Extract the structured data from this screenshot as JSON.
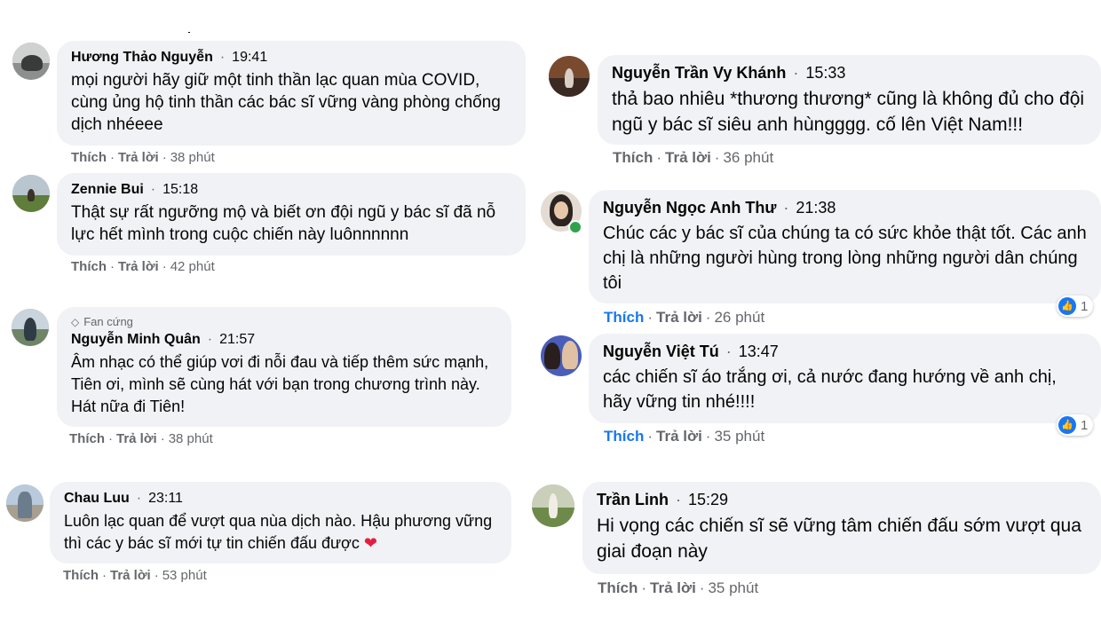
{
  "left_column": [
    {
      "name": "Hương Thảo Nguyễn",
      "time": "19:41",
      "text": "mọi người hãy giữ một tinh thần lạc quan mùa COVID, cùng ủng hộ tinh thần các bác sĩ vững vàng phòng chống dịch nhéeee",
      "like_label": "Thích",
      "reply_label": "Trả lời",
      "ago": "38 phút"
    },
    {
      "name": "Zennie Bui",
      "time": "15:18",
      "text": "Thật sự rất ngưỡng mộ và biết ơn đội ngũ y bác sĩ đã nỗ lực hết mình trong cuộc chiến này luônnnnnn",
      "like_label": "Thích",
      "reply_label": "Trả lời",
      "ago": "42 phút"
    },
    {
      "badge": "Fan cứng",
      "name": "Nguyễn Minh Quân",
      "time": "21:57",
      "text": "Âm nhạc có thể giúp vơi đi nỗi đau và tiếp thêm sức mạnh, Tiên ơi, mình sẽ cùng hát với bạn trong chương trình này. Hát nữa đi Tiên!",
      "like_label": "Thích",
      "reply_label": "Trả lời",
      "ago": "38 phút"
    },
    {
      "name": "Chau Luu",
      "time": "23:11",
      "text": "Luôn lạc quan để vượt qua nùa dịch nào. Hậu phương vững thì các y bác sĩ mới tự tin chiến đấu được",
      "emoji": "❤",
      "like_label": "Thích",
      "reply_label": "Trả lời",
      "ago": "53 phút"
    }
  ],
  "right_column": [
    {
      "name": "Nguyễn Trần Vy Khánh",
      "time": "15:33",
      "text": "thả bao nhiêu *thương thương* cũng là không đủ cho đội ngũ y bác sĩ siêu anh hùngggg. cố lên Việt Nam!!!",
      "like_label": "Thích",
      "reply_label": "Trả lời",
      "ago": "36 phút"
    },
    {
      "name": "Nguyễn Ngọc Anh Thư",
      "time": "21:38",
      "text": "Chúc các y bác sĩ của chúng ta có sức khỏe thật tốt. Các anh chị là những người hùng trong lòng những người dân chúng tôi",
      "like_label": "Thích",
      "reply_label": "Trả lời",
      "ago": "26 phút",
      "reactions": "1",
      "liked": true
    },
    {
      "name": "Nguyễn Việt Tú",
      "time": "13:47",
      "text": "các chiến sĩ áo trắng ơi, cả nước đang hướng về anh chị, hãy vững tin nhé!!!!",
      "like_label": "Thích",
      "reply_label": "Trả lời",
      "ago": "35 phút",
      "reactions": "1",
      "liked": true
    },
    {
      "name": "Trần Linh",
      "time": "15:29",
      "text": "Hi vọng các chiến sĩ sẽ vững tâm chiến đấu sớm vượt qua giai đoạn này",
      "like_label": "Thích",
      "reply_label": "Trả lời",
      "ago": "35 phút"
    }
  ],
  "separator": "·",
  "icons": {
    "badge": "diamond-icon",
    "reaction": "thumbs-up-icon",
    "online": "online-status-icon"
  },
  "colors": {
    "bubble": "#f0f2f5",
    "link_blue": "#1877f2",
    "muted": "#65676b",
    "online": "#31a24c"
  }
}
